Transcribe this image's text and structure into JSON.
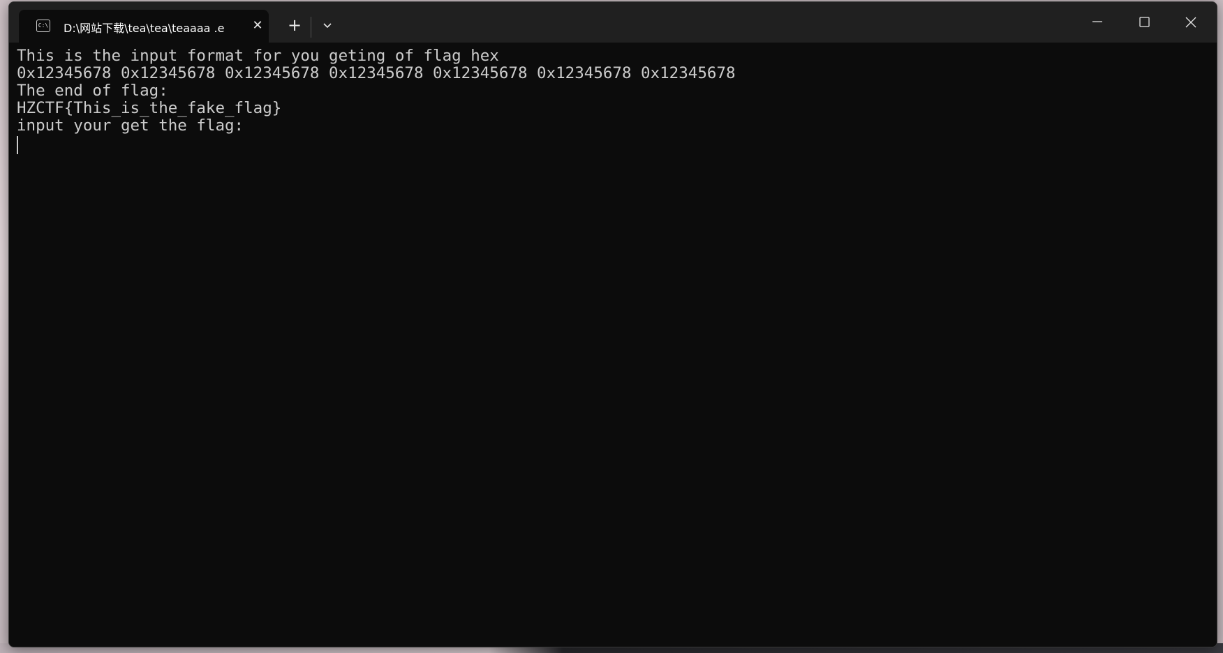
{
  "window": {
    "tab_title": "D:\\网站下载\\tea\\tea\\teaaaa .e",
    "tab_icon_text": "C:\\",
    "close_tab_glyph": "✕",
    "new_tab_glyph": "+"
  },
  "terminal": {
    "lines": [
      "This is the input format for you geting of flag hex",
      "0x12345678 0x12345678 0x12345678 0x12345678 0x12345678 0x12345678 0x12345678",
      "The end of flag:",
      "HZCTF{This_is_the_fake_flag}",
      "input your get the flag:"
    ]
  },
  "colors": {
    "terminal_bg": "#0c0c0c",
    "terminal_fg": "#cccccc",
    "titlebar_bg": "#202020"
  }
}
